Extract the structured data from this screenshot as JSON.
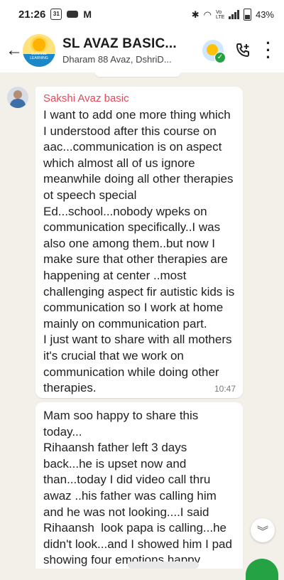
{
  "status_bar": {
    "time": "21:26",
    "calendar_badge": "31",
    "battery": "43%",
    "net_label": "Vo LTE"
  },
  "header": {
    "back_icon": "arrow-left-icon",
    "title": "SL AVAZ BASIC...",
    "subtitle": "Dharam 88 Avaz, DshriD...",
    "avatar_text": "SUNRISE LEARNING"
  },
  "messages": [
    {
      "sender": "Sakshi Avaz basic",
      "sender_color": "#e5475b",
      "text": "I want to add one more thing which I understood after this course on aac...communication is on aspect which almost all of us ignore meanwhile doing all other therapies ot speech special Ed...school...nobody wpeks on communication specifically..I was also one among them..but now I make sure that other therapies are happening at center ..most challenging aspect fir autistic kids is communication so I work at home mainly on communication part.\nI just want to share with all mothers it's crucial that we work on communication while doing other therapies.",
      "time": "10:47"
    },
    {
      "text": "Mam soo happy to share this today...\nRihaansh father left 3 days back...he is upset now and than...today I did video call thru awaz ..his father was calling him and he was not looking....I said Rihaansh  look papa is calling...he didn't look...and I showed him I pad showing four emotions happy"
    }
  ],
  "colors": {
    "chat_bg": "#f3efe9",
    "accent_green": "#25a244"
  }
}
